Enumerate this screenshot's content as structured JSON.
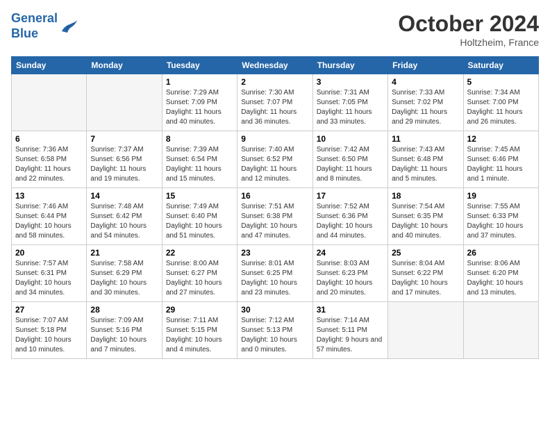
{
  "header": {
    "logo_line1": "General",
    "logo_line2": "Blue",
    "month": "October 2024",
    "location": "Holtzheim, France"
  },
  "weekdays": [
    "Sunday",
    "Monday",
    "Tuesday",
    "Wednesday",
    "Thursday",
    "Friday",
    "Saturday"
  ],
  "weeks": [
    [
      {
        "day": "",
        "info": ""
      },
      {
        "day": "",
        "info": ""
      },
      {
        "day": "1",
        "info": "Sunrise: 7:29 AM\nSunset: 7:09 PM\nDaylight: 11 hours and 40 minutes."
      },
      {
        "day": "2",
        "info": "Sunrise: 7:30 AM\nSunset: 7:07 PM\nDaylight: 11 hours and 36 minutes."
      },
      {
        "day": "3",
        "info": "Sunrise: 7:31 AM\nSunset: 7:05 PM\nDaylight: 11 hours and 33 minutes."
      },
      {
        "day": "4",
        "info": "Sunrise: 7:33 AM\nSunset: 7:02 PM\nDaylight: 11 hours and 29 minutes."
      },
      {
        "day": "5",
        "info": "Sunrise: 7:34 AM\nSunset: 7:00 PM\nDaylight: 11 hours and 26 minutes."
      }
    ],
    [
      {
        "day": "6",
        "info": "Sunrise: 7:36 AM\nSunset: 6:58 PM\nDaylight: 11 hours and 22 minutes."
      },
      {
        "day": "7",
        "info": "Sunrise: 7:37 AM\nSunset: 6:56 PM\nDaylight: 11 hours and 19 minutes."
      },
      {
        "day": "8",
        "info": "Sunrise: 7:39 AM\nSunset: 6:54 PM\nDaylight: 11 hours and 15 minutes."
      },
      {
        "day": "9",
        "info": "Sunrise: 7:40 AM\nSunset: 6:52 PM\nDaylight: 11 hours and 12 minutes."
      },
      {
        "day": "10",
        "info": "Sunrise: 7:42 AM\nSunset: 6:50 PM\nDaylight: 11 hours and 8 minutes."
      },
      {
        "day": "11",
        "info": "Sunrise: 7:43 AM\nSunset: 6:48 PM\nDaylight: 11 hours and 5 minutes."
      },
      {
        "day": "12",
        "info": "Sunrise: 7:45 AM\nSunset: 6:46 PM\nDaylight: 11 hours and 1 minute."
      }
    ],
    [
      {
        "day": "13",
        "info": "Sunrise: 7:46 AM\nSunset: 6:44 PM\nDaylight: 10 hours and 58 minutes."
      },
      {
        "day": "14",
        "info": "Sunrise: 7:48 AM\nSunset: 6:42 PM\nDaylight: 10 hours and 54 minutes."
      },
      {
        "day": "15",
        "info": "Sunrise: 7:49 AM\nSunset: 6:40 PM\nDaylight: 10 hours and 51 minutes."
      },
      {
        "day": "16",
        "info": "Sunrise: 7:51 AM\nSunset: 6:38 PM\nDaylight: 10 hours and 47 minutes."
      },
      {
        "day": "17",
        "info": "Sunrise: 7:52 AM\nSunset: 6:36 PM\nDaylight: 10 hours and 44 minutes."
      },
      {
        "day": "18",
        "info": "Sunrise: 7:54 AM\nSunset: 6:35 PM\nDaylight: 10 hours and 40 minutes."
      },
      {
        "day": "19",
        "info": "Sunrise: 7:55 AM\nSunset: 6:33 PM\nDaylight: 10 hours and 37 minutes."
      }
    ],
    [
      {
        "day": "20",
        "info": "Sunrise: 7:57 AM\nSunset: 6:31 PM\nDaylight: 10 hours and 34 minutes."
      },
      {
        "day": "21",
        "info": "Sunrise: 7:58 AM\nSunset: 6:29 PM\nDaylight: 10 hours and 30 minutes."
      },
      {
        "day": "22",
        "info": "Sunrise: 8:00 AM\nSunset: 6:27 PM\nDaylight: 10 hours and 27 minutes."
      },
      {
        "day": "23",
        "info": "Sunrise: 8:01 AM\nSunset: 6:25 PM\nDaylight: 10 hours and 23 minutes."
      },
      {
        "day": "24",
        "info": "Sunrise: 8:03 AM\nSunset: 6:23 PM\nDaylight: 10 hours and 20 minutes."
      },
      {
        "day": "25",
        "info": "Sunrise: 8:04 AM\nSunset: 6:22 PM\nDaylight: 10 hours and 17 minutes."
      },
      {
        "day": "26",
        "info": "Sunrise: 8:06 AM\nSunset: 6:20 PM\nDaylight: 10 hours and 13 minutes."
      }
    ],
    [
      {
        "day": "27",
        "info": "Sunrise: 7:07 AM\nSunset: 5:18 PM\nDaylight: 10 hours and 10 minutes."
      },
      {
        "day": "28",
        "info": "Sunrise: 7:09 AM\nSunset: 5:16 PM\nDaylight: 10 hours and 7 minutes."
      },
      {
        "day": "29",
        "info": "Sunrise: 7:11 AM\nSunset: 5:15 PM\nDaylight: 10 hours and 4 minutes."
      },
      {
        "day": "30",
        "info": "Sunrise: 7:12 AM\nSunset: 5:13 PM\nDaylight: 10 hours and 0 minutes."
      },
      {
        "day": "31",
        "info": "Sunrise: 7:14 AM\nSunset: 5:11 PM\nDaylight: 9 hours and 57 minutes."
      },
      {
        "day": "",
        "info": ""
      },
      {
        "day": "",
        "info": ""
      }
    ]
  ]
}
